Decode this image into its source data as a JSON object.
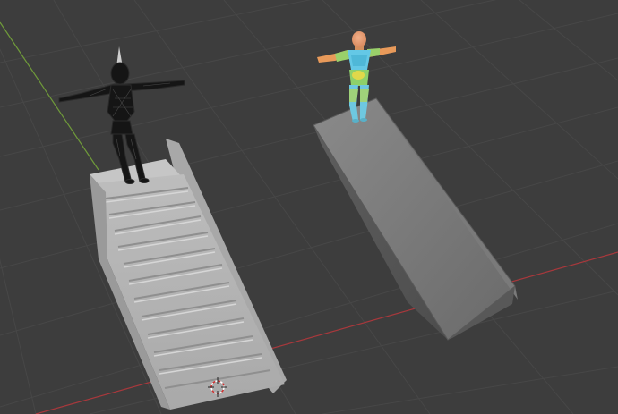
{
  "viewport": {
    "background_color": "#3d3d3d",
    "grid_color": "#4a4a4a",
    "x_axis_color": "#b63a3f",
    "y_axis_color": "#79a83a"
  },
  "scene": {
    "objects": [
      {
        "name": "stairs-mesh",
        "color": "#b9b9b9"
      },
      {
        "name": "wireframe-character",
        "color": "#111111"
      },
      {
        "name": "ramp-mesh",
        "color": "#6f6f6f"
      },
      {
        "name": "colored-character",
        "color": "#64c8e6"
      }
    ],
    "cursor": {
      "name": "3d-cursor-icon"
    }
  }
}
